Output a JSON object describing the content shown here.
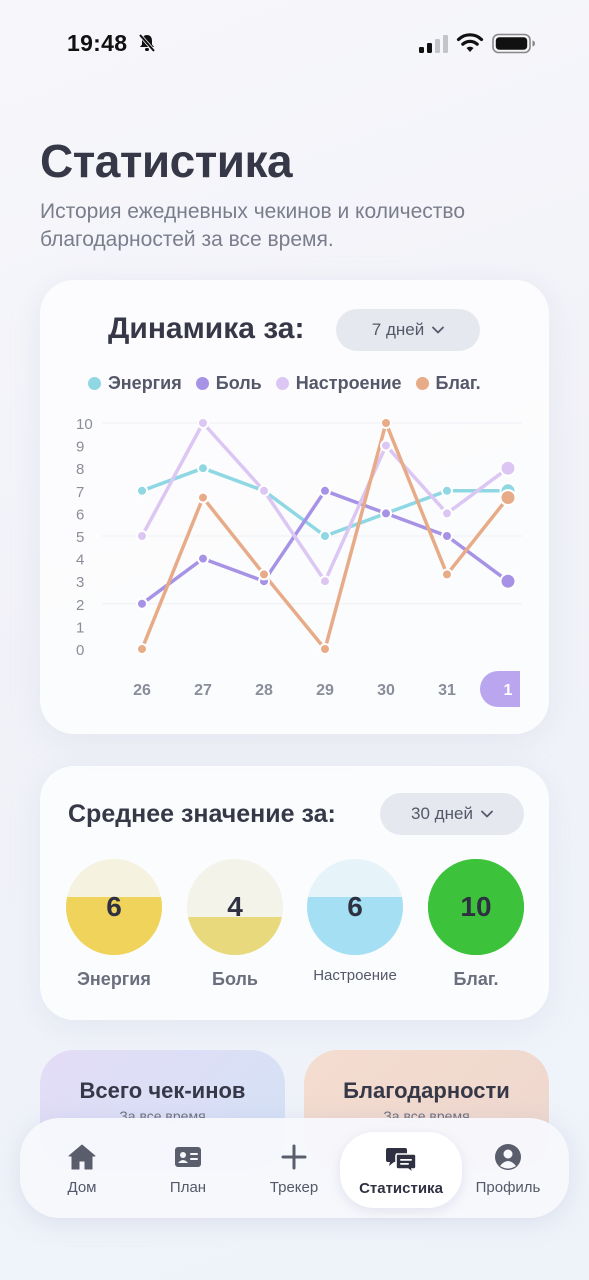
{
  "status_bar": {
    "time": "19:48"
  },
  "page": {
    "title": "Статистика",
    "subtitle": "История ежедневных чекинов и количество благодарностей за все время."
  },
  "dynamics": {
    "title": "Динамика за:",
    "period": "7 дней",
    "legend": [
      {
        "label": "Энергия",
        "color": "#8fd8e3"
      },
      {
        "label": "Боль",
        "color": "#a793e6"
      },
      {
        "label": "Настроение",
        "color": "#dcc6f3"
      },
      {
        "label": "Благ.",
        "color": "#e8ab88"
      }
    ]
  },
  "chart_data": {
    "type": "line",
    "categories": [
      "26",
      "27",
      "28",
      "29",
      "30",
      "31",
      "1"
    ],
    "selected_category": "1",
    "ylim": [
      0,
      10
    ],
    "yticks": [
      "10",
      "9",
      "8",
      "7",
      "6",
      "5",
      "4",
      "3",
      "2",
      "1",
      "0"
    ],
    "grid": true,
    "series": [
      {
        "name": "Энергия",
        "color": "#8fd8e3",
        "values": [
          7,
          8,
          7,
          5,
          6,
          7,
          7
        ]
      },
      {
        "name": "Боль",
        "color": "#a793e6",
        "values": [
          2,
          4,
          3,
          7,
          6,
          5,
          3
        ]
      },
      {
        "name": "Настроение",
        "color": "#dcc6f3",
        "values": [
          5,
          10,
          7,
          3,
          9,
          6,
          8
        ]
      },
      {
        "name": "Благ.",
        "color": "#e8ab88",
        "values": [
          0,
          6.7,
          3.3,
          0,
          10,
          3.3,
          6.7
        ]
      }
    ]
  },
  "average": {
    "title": "Среднее значение за:",
    "period": "30 дней",
    "items": [
      {
        "label": "Энергия",
        "value": "6",
        "fill": 0.6,
        "fill_color": "#f0d35a",
        "bg_color": "#f6f2e0"
      },
      {
        "label": "Боль",
        "value": "4",
        "fill": 0.4,
        "fill_color": "#e8d97c",
        "bg_color": "#f4f3ea"
      },
      {
        "label": "Настроение",
        "value": "6",
        "fill": 0.6,
        "fill_color": "#a5dff3",
        "bg_color": "#e6f3f8"
      },
      {
        "label": "Благ.",
        "value": "10",
        "fill": 1.0,
        "fill_color": "#3dc33b",
        "bg_color": "#3dc33b"
      }
    ]
  },
  "summary": {
    "checkins_title": "Всего чек-инов",
    "checkins_sub": "За все время",
    "gratitude_title": "Благодарности",
    "gratitude_sub": "За все время"
  },
  "tabs": [
    {
      "label": "Дом",
      "icon": "home-icon"
    },
    {
      "label": "План",
      "icon": "id-card-icon"
    },
    {
      "label": "Трекер",
      "icon": "plus-icon"
    },
    {
      "label": "Статистика",
      "icon": "chat-bubbles-icon",
      "active": true
    },
    {
      "label": "Профиль",
      "icon": "profile-icon"
    }
  ]
}
